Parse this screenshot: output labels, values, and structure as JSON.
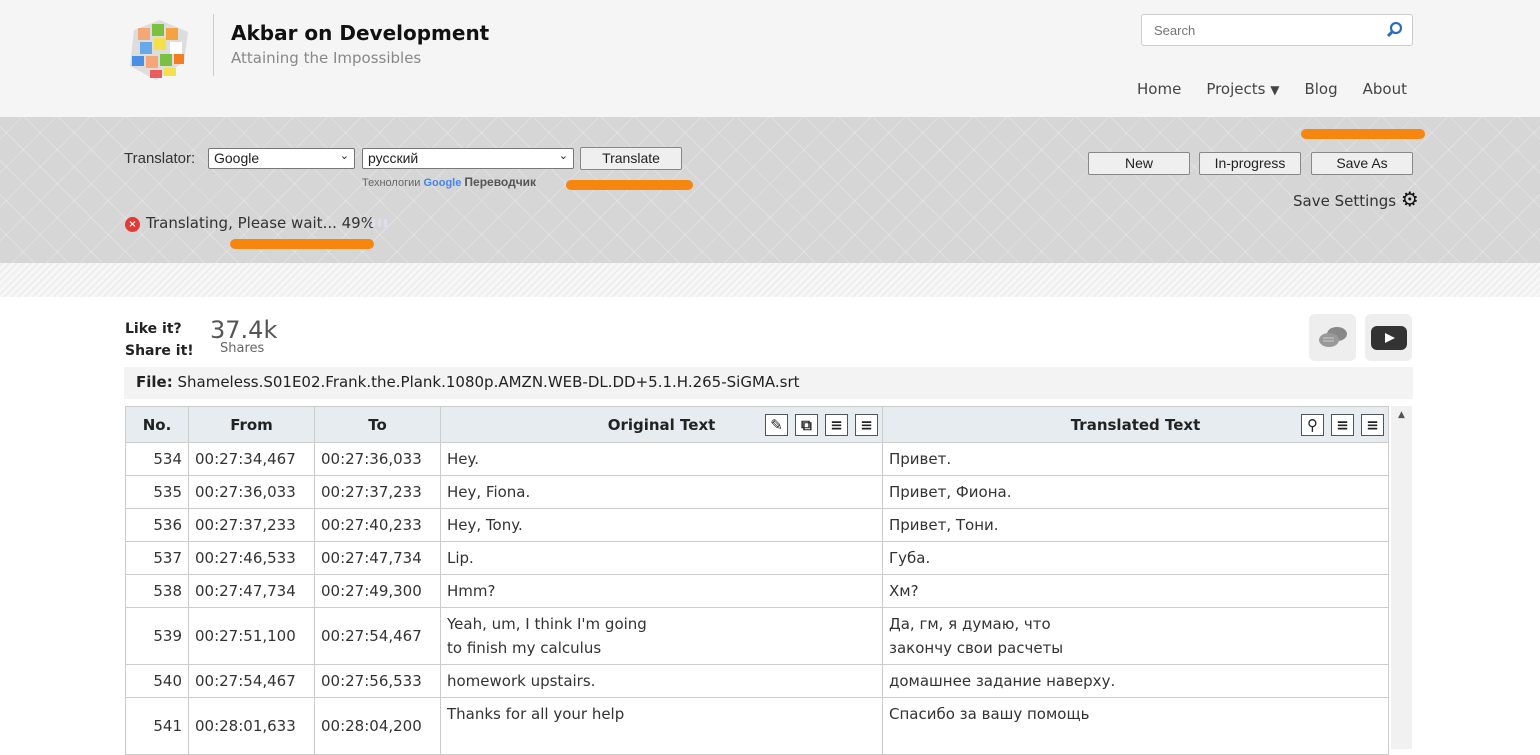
{
  "site": {
    "title": "Akbar on Development",
    "subtitle": "Attaining the Impossibles",
    "search_placeholder": "Search"
  },
  "nav": [
    {
      "label": "Home"
    },
    {
      "label": "Projects"
    },
    {
      "label": "Blog"
    },
    {
      "label": "About"
    }
  ],
  "translator": {
    "label": "Translator:",
    "engine": "Google",
    "language": "русский",
    "translate_label": "Translate",
    "powered_prefix": "Технологии",
    "powered_brand": "Google",
    "powered_suffix": "Переводчик",
    "status": "Translating, Please wait... 49%",
    "progress_percent": 49
  },
  "actions": {
    "new": "New",
    "in_progress": "In-progress",
    "save_as": "Save As",
    "save_settings": "Save Settings"
  },
  "share": {
    "like": "Like it?",
    "share": "Share it!",
    "count": "37.4k",
    "count_label": "Shares"
  },
  "file": {
    "label": "File:",
    "name": "Shameless.S01E02.Frank.the.Plank.1080p.AMZN.WEB-DL.DD+5.1.H.265-SiGMA.srt"
  },
  "table": {
    "headers": {
      "no": "No.",
      "from": "From",
      "to": "To",
      "original": "Original Text",
      "translated": "Translated Text"
    },
    "rows": [
      {
        "no": "534",
        "from": "00:27:34,467",
        "to": "00:27:36,033",
        "orig": [
          "Hey."
        ],
        "trans": [
          "Привет."
        ]
      },
      {
        "no": "535",
        "from": "00:27:36,033",
        "to": "00:27:37,233",
        "orig": [
          "Hey, Fiona."
        ],
        "trans": [
          "Привет, Фиона."
        ]
      },
      {
        "no": "536",
        "from": "00:27:37,233",
        "to": "00:27:40,233",
        "orig": [
          "Hey, Tony."
        ],
        "trans": [
          "Привет, Тони."
        ]
      },
      {
        "no": "537",
        "from": "00:27:46,533",
        "to": "00:27:47,734",
        "orig": [
          "Lip."
        ],
        "trans": [
          "Губа."
        ]
      },
      {
        "no": "538",
        "from": "00:27:47,734",
        "to": "00:27:49,300",
        "orig": [
          "Hmm?"
        ],
        "trans": [
          "Хм?"
        ]
      },
      {
        "no": "539",
        "from": "00:27:51,100",
        "to": "00:27:54,467",
        "orig": [
          "Yeah, um, I think I'm going",
          "to finish my calculus"
        ],
        "trans": [
          "Да, гм, я думаю, что",
          "закончу свои расчеты"
        ]
      },
      {
        "no": "540",
        "from": "00:27:54,467",
        "to": "00:27:56,533",
        "orig": [
          "homework upstairs."
        ],
        "trans": [
          "домашнее задание наверху."
        ]
      },
      {
        "no": "541",
        "from": "00:28:01,633",
        "to": "00:28:04,200",
        "orig": [
          "Thanks for all your help",
          ""
        ],
        "trans": [
          "Спасибо за вашу помощь",
          ""
        ]
      }
    ]
  },
  "colors": {
    "accent": "#f7860e",
    "header_bg": "#e6ecef"
  }
}
